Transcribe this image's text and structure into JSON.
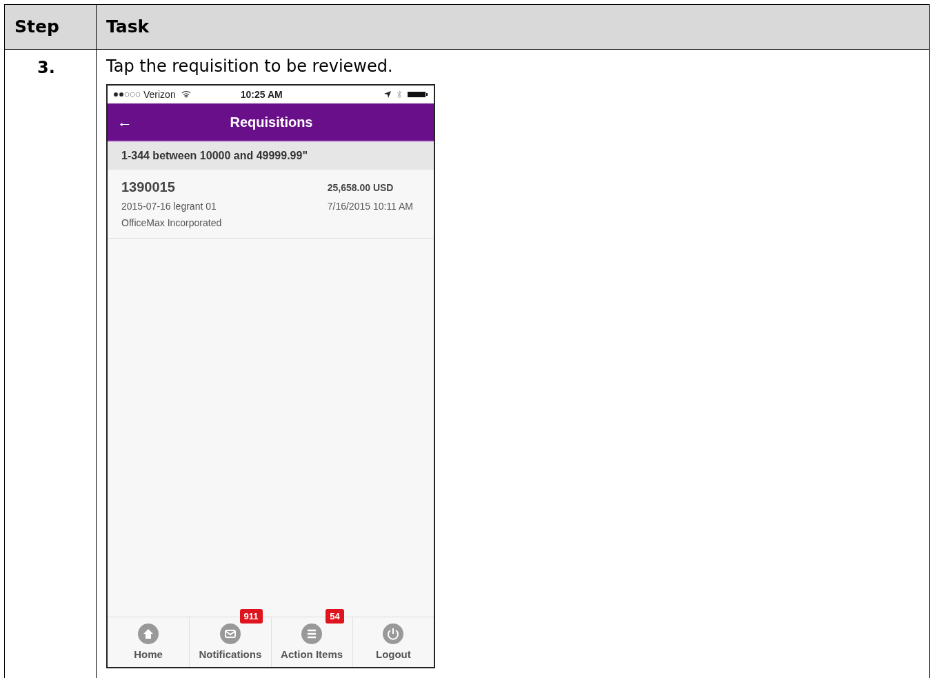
{
  "table": {
    "columns": [
      "Step",
      "Task"
    ],
    "rows": [
      {
        "step": "3.",
        "task": "Tap the requisition to be reviewed.",
        "phone": {
          "status_bar": {
            "carrier": "Verizon",
            "time": "10:25 AM"
          },
          "header": {
            "back": "←",
            "title": "Requisitions"
          },
          "filter": "1-344 between 10000 and 49999.99\"",
          "requisitions": [
            {
              "number": "1390015",
              "amount": "25,658.00 USD",
              "description": "2015-07-16 legrant 01",
              "date": "7/16/2015 10:11 AM",
              "supplier": "OfficeMax Incorporated"
            }
          ],
          "tab_bar": [
            {
              "label": "Home"
            },
            {
              "label": "Notifications",
              "badge": "911"
            },
            {
              "label": "Action Items",
              "badge": "54"
            },
            {
              "label": "Logout"
            }
          ]
        }
      }
    ]
  }
}
